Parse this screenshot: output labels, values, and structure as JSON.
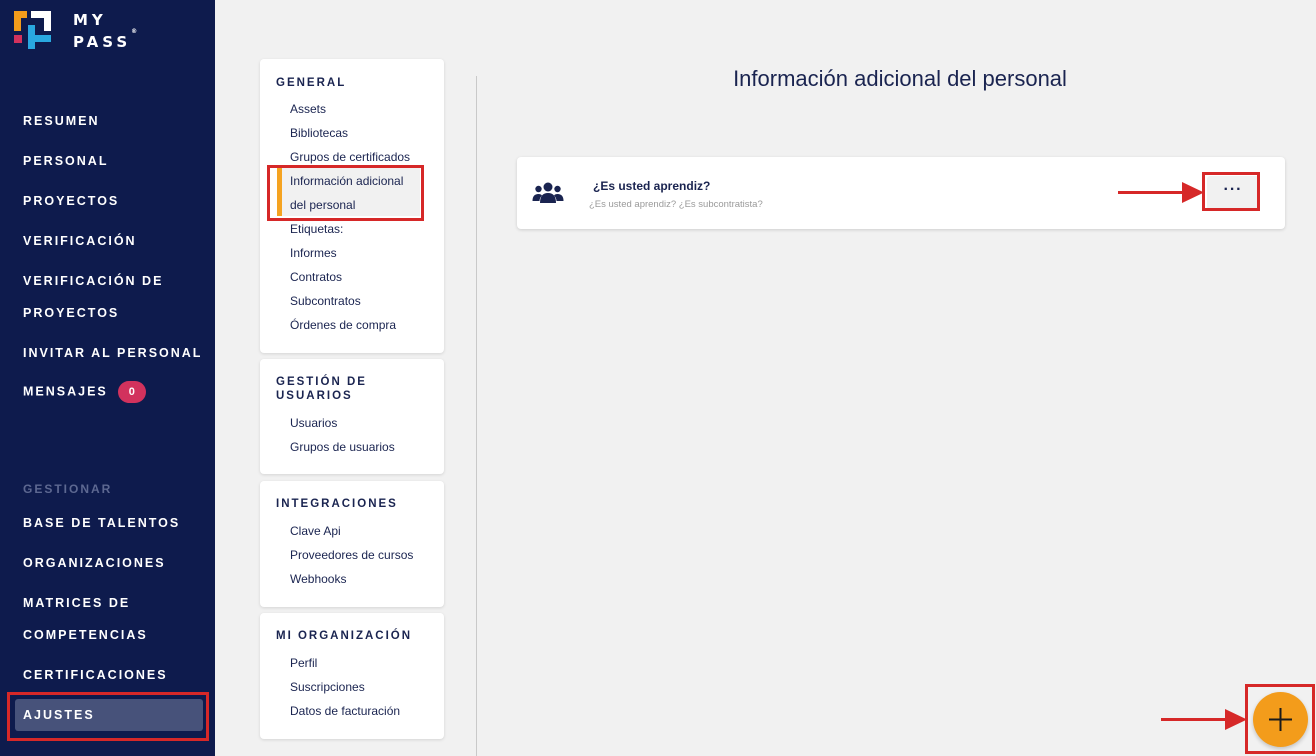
{
  "brand": {
    "line1": "MY",
    "line2": "PASS",
    "mark": "®"
  },
  "sidebar": {
    "items": [
      {
        "label": "RESUMEN"
      },
      {
        "label": "PERSONAL"
      },
      {
        "label": "PROYECTOS"
      },
      {
        "label": "VERIFICACIÓN"
      },
      {
        "label": "VERIFICACIÓN DE",
        "label2": "PROYECTOS"
      },
      {
        "label": "INVITAR AL PERSONAL"
      },
      {
        "label": "MENSAJES",
        "badge": "0"
      }
    ],
    "section_label": "GESTIONAR",
    "manage_items": [
      {
        "label": "BASE DE TALENTOS"
      },
      {
        "label": "ORGANIZACIONES"
      },
      {
        "label": "MATRICES DE",
        "label2": "COMPETENCIAS"
      },
      {
        "label": "CERTIFICACIONES"
      },
      {
        "label": "AJUSTES"
      }
    ]
  },
  "settings_menu": {
    "general": {
      "title": "GENERAL",
      "links": [
        "Assets",
        "Bibliotecas",
        "Grupos de certificados",
        "Información adicional",
        "del personal",
        "Etiquetas:",
        "Informes",
        "Contratos",
        "Subcontratos",
        "Órdenes de compra"
      ]
    },
    "users": {
      "title_line1": "GESTIÓN DE",
      "title_line2": "USUARIOS",
      "links": [
        "Usuarios",
        "Grupos de usuarios"
      ]
    },
    "integrations": {
      "title": "INTEGRACIONES",
      "links": [
        "Clave Api",
        "Proveedores de cursos",
        "Webhooks"
      ]
    },
    "organization": {
      "title": "MI ORGANIZACIÓN",
      "links": [
        "Perfil",
        "Suscripciones",
        "Datos de facturación"
      ]
    }
  },
  "main": {
    "title": "Información adicional del personal",
    "items": [
      {
        "title": "¿Es usted aprendiz?",
        "subtitle": "¿Es usted aprendiz? ¿Es subcontratista?",
        "more_label": "···"
      }
    ]
  },
  "colors": {
    "sidebar_bg": "#0e1b4d",
    "accent": "#f39c1b",
    "badge": "#d2325d",
    "highlight": "#d62828"
  }
}
